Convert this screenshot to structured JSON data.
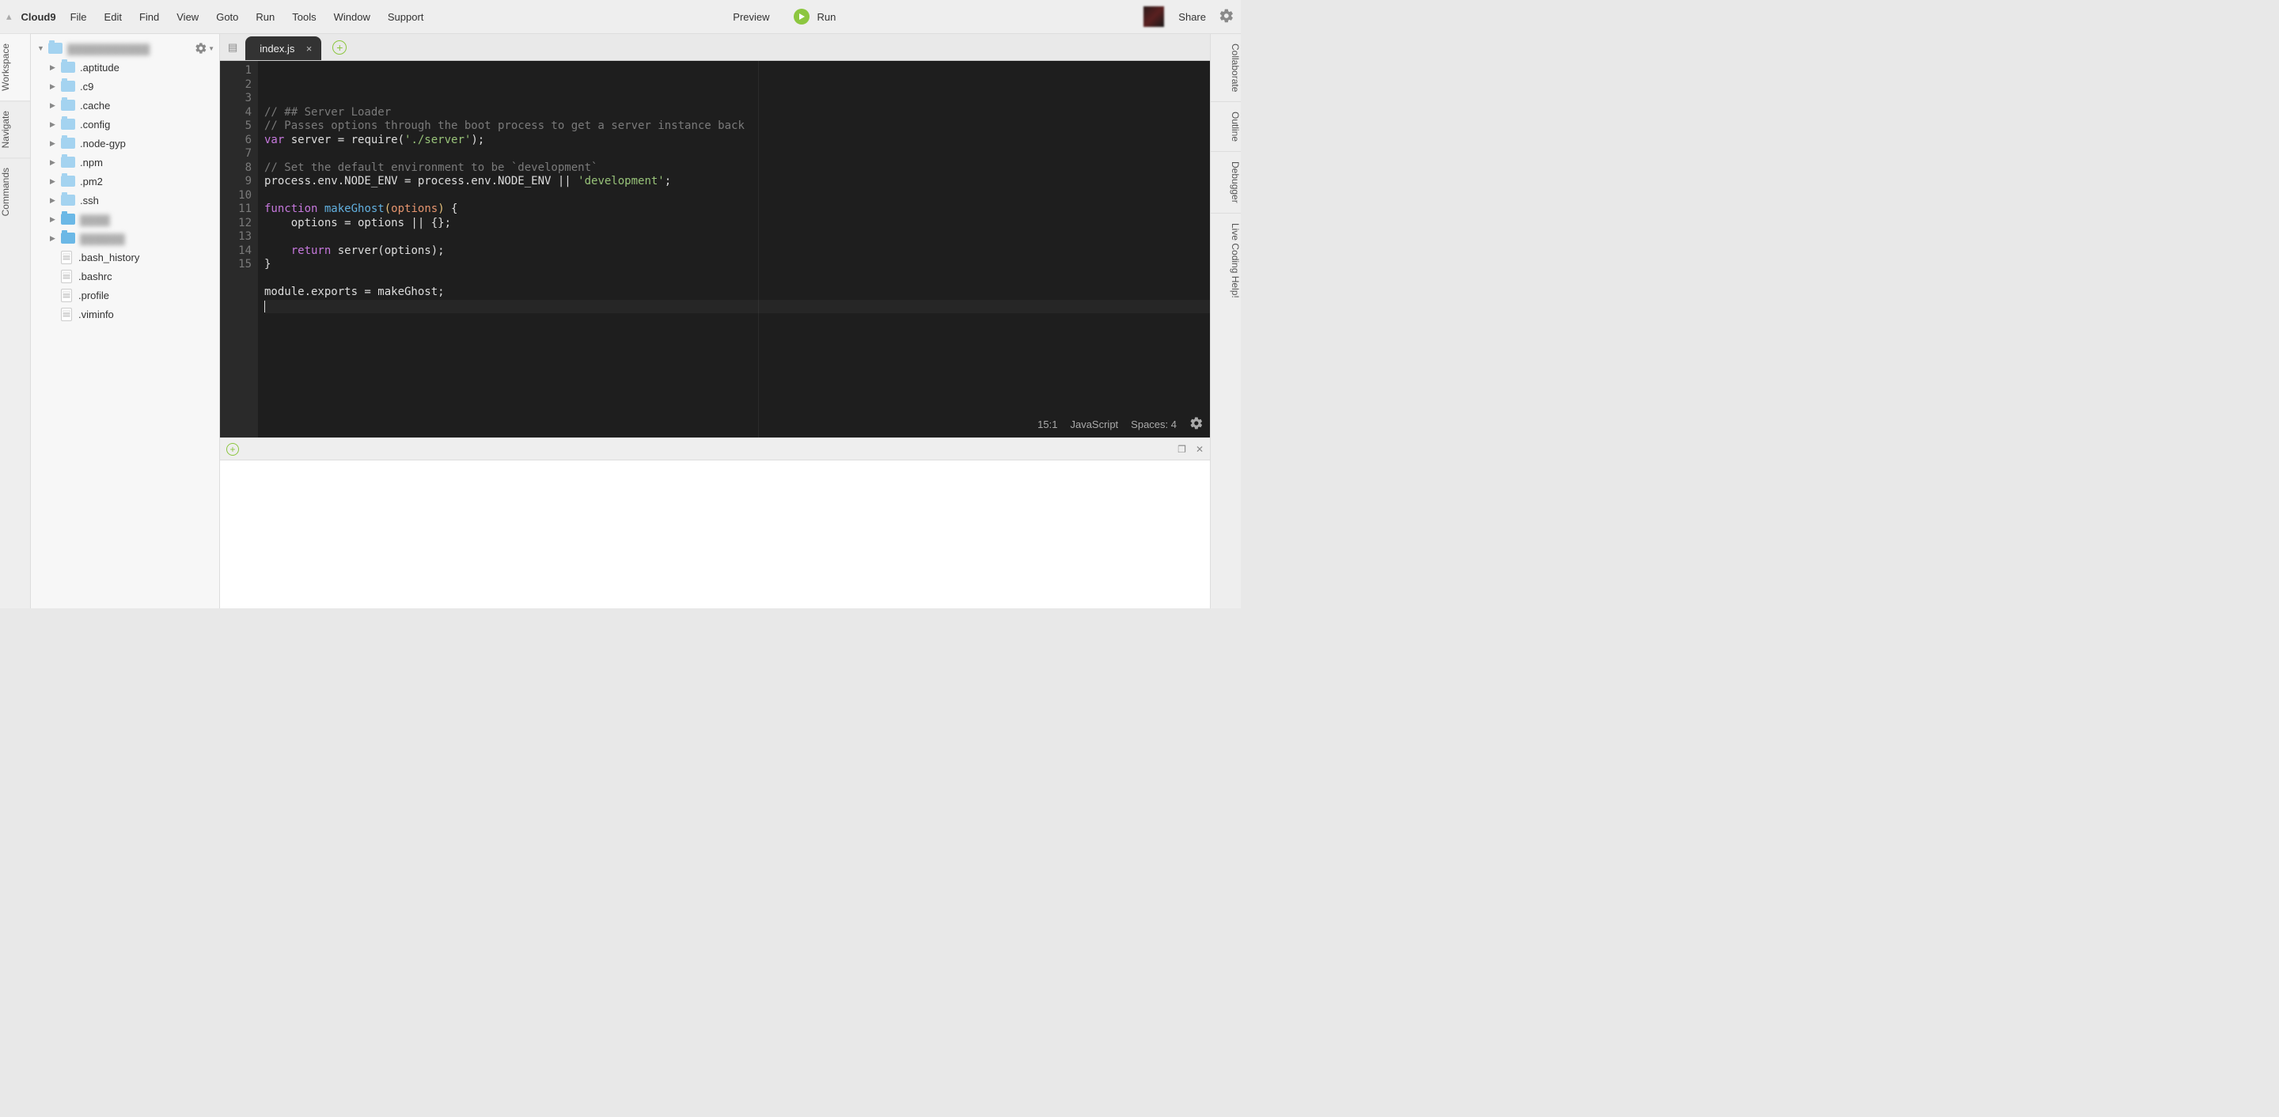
{
  "menubar": {
    "brand": "Cloud9",
    "items": [
      "File",
      "Edit",
      "Find",
      "View",
      "Goto",
      "Run",
      "Tools",
      "Window",
      "Support"
    ],
    "preview": "Preview",
    "run": "Run",
    "share": "Share"
  },
  "left_rail": [
    "Workspace",
    "Navigate",
    "Commands"
  ],
  "right_rail": [
    "Collaborate",
    "Outline",
    "Debugger",
    "Live Coding Help!"
  ],
  "sidebar": {
    "root_label": "▓▓▓▓▓▓▓▓▓▓▓",
    "folders": [
      ".aptitude",
      ".c9",
      ".cache",
      ".config",
      ".node-gyp",
      ".npm",
      ".pm2",
      ".ssh"
    ],
    "blurred": [
      "▓▓▓▓",
      "▓▓▓▓▓▓"
    ],
    "files": [
      ".bash_history",
      ".bashrc",
      ".profile",
      ".viminfo"
    ]
  },
  "tab": {
    "name": "index.js"
  },
  "code": {
    "lines": [
      [
        {
          "t": "// ## Server Loader",
          "c": "c-comment"
        }
      ],
      [
        {
          "t": "// Passes options through the boot process to get a server instance back",
          "c": "c-comment"
        }
      ],
      [
        {
          "t": "var",
          "c": "c-keyword"
        },
        {
          "t": " server = require("
        },
        {
          "t": "'./server'",
          "c": "c-string"
        },
        {
          "t": ");"
        }
      ],
      [],
      [
        {
          "t": "// Set the default environment to be `development`",
          "c": "c-comment"
        }
      ],
      [
        {
          "t": "process.env.NODE_ENV = process.env.NODE_ENV || "
        },
        {
          "t": "'development'",
          "c": "c-string"
        },
        {
          "t": ";"
        }
      ],
      [],
      [
        {
          "t": "function",
          "c": "c-keyword"
        },
        {
          "t": " "
        },
        {
          "t": "makeGhost",
          "c": "c-func"
        },
        {
          "t": "(",
          "c": "c-paren"
        },
        {
          "t": "options",
          "c": "c-param"
        },
        {
          "t": ")",
          "c": "c-paren"
        },
        {
          "t": " {"
        }
      ],
      [
        {
          "t": "    options = options || {};"
        }
      ],
      [],
      [
        {
          "t": "    "
        },
        {
          "t": "return",
          "c": "c-keyword"
        },
        {
          "t": " server(options);"
        }
      ],
      [
        {
          "t": "}"
        }
      ],
      [],
      [
        {
          "t": "module.exports = makeGhost;"
        }
      ],
      []
    ],
    "active_line": 15
  },
  "status": {
    "pos": "15:1",
    "lang": "JavaScript",
    "spaces": "Spaces: 4"
  }
}
